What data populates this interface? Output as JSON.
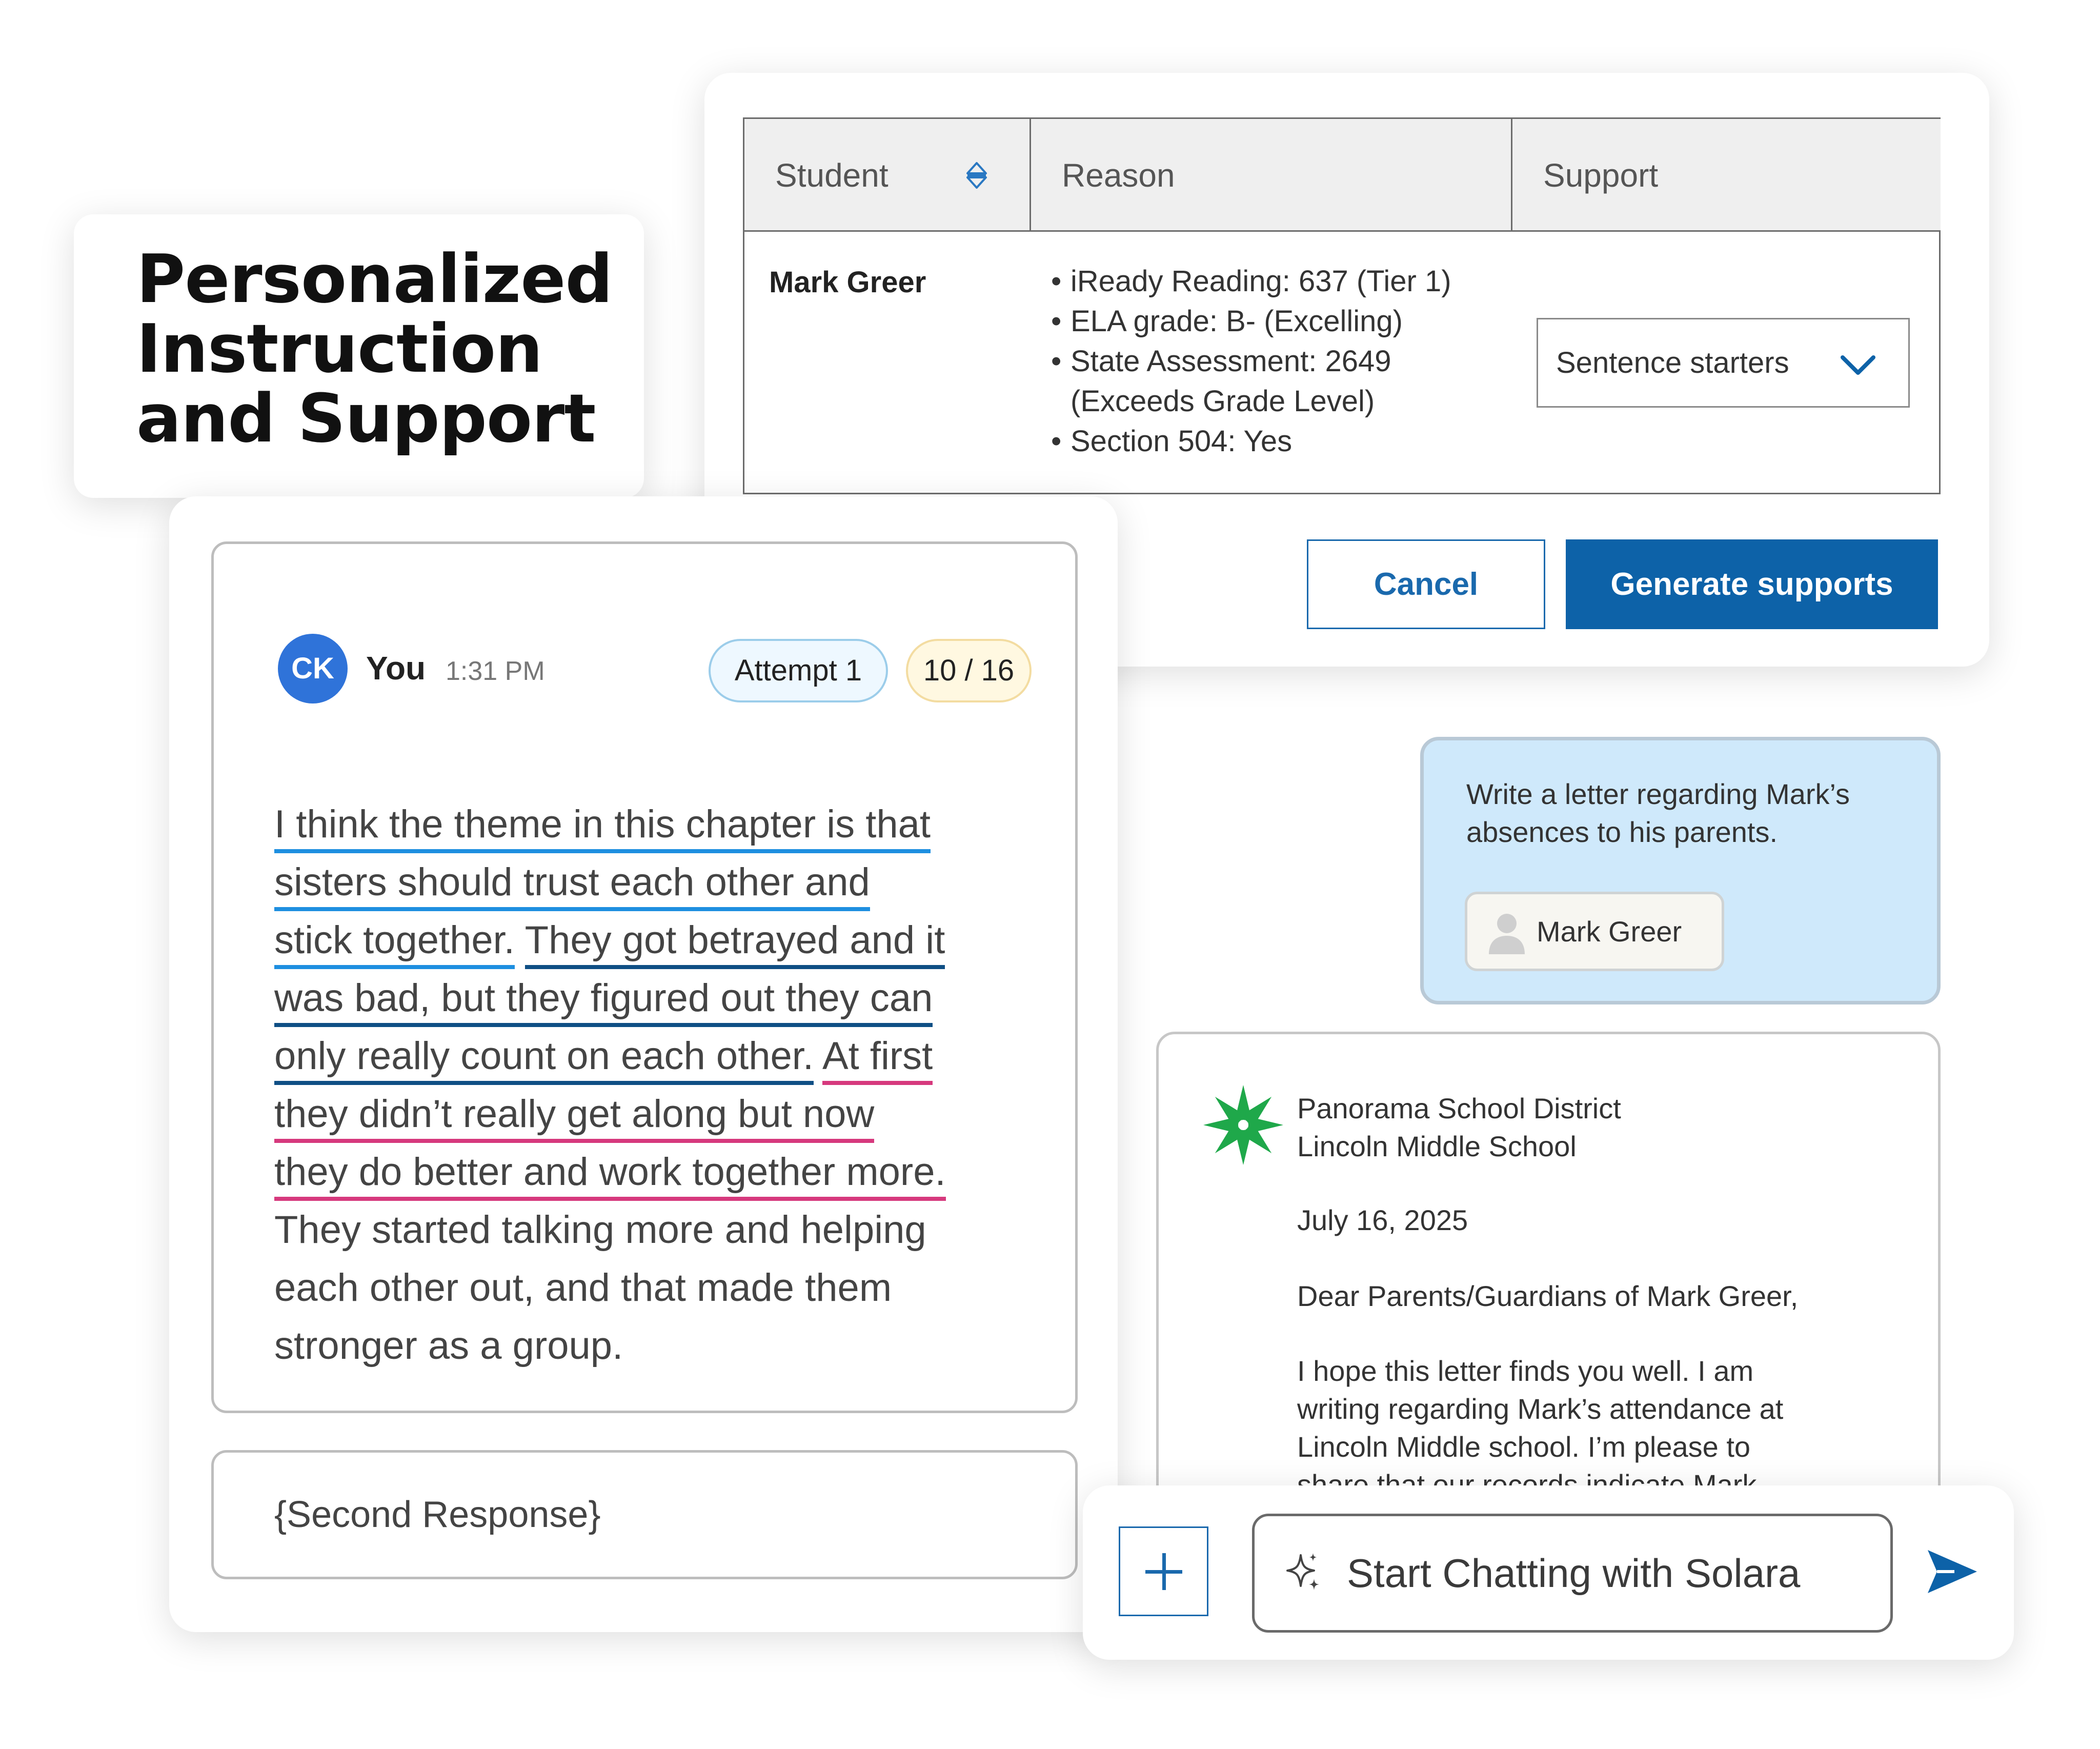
{
  "title_card": {
    "lines": [
      "Personalized",
      "Instruction",
      "and Support"
    ]
  },
  "support_table": {
    "columns": {
      "student": "Student",
      "reason": "Reason",
      "support": "Support"
    },
    "row": {
      "student": "Mark Greer",
      "reasons": [
        "iReady Reading: 637 (Tier 1)",
        "ELA grade: B- (Excelling)",
        "State Assessment: 2649",
        "(Exceeds Grade Level)",
        "Section 504: Yes"
      ],
      "support_selected": "Sentence starters"
    },
    "cancel_label": "Cancel",
    "generate_label": "Generate supports"
  },
  "response": {
    "avatar_initials": "CK",
    "author": "You",
    "time": "1:31 PM",
    "attempt_label": "Attempt 1",
    "score_label": "10 / 16",
    "lines": [
      "I think the theme in this chapter is that",
      "sisters should trust each other and",
      "stick together.",
      "They got betrayed and it",
      "was bad, but they figured out they can",
      "only really count on each other.",
      "At first",
      "they didn’t really get along but now",
      "they do better and work together more.",
      "They started talking more and helping",
      "each other out, and that made them",
      "stronger as a group."
    ],
    "second_response": "{Second Response}"
  },
  "prompt": {
    "text": "Write a letter regarding Mark’s absences to his parents.",
    "chip_label": "Mark Greer"
  },
  "letter": {
    "district": "Panorama School District",
    "school": "Lincoln Middle School",
    "date": "July 16, 2025",
    "greeting": "Dear Parents/Guardians of Mark Greer,",
    "body_lines": [
      "I hope this letter finds you well. I am",
      "writing regarding Mark’s attendance at",
      "Lincoln Middle school. I’m please to",
      "share that our records indicate Mark"
    ]
  },
  "chat": {
    "placeholder": "Start Chatting with Solara"
  },
  "colors": {
    "primary_blue": "#0d62a8",
    "avatar_blue": "#2f73d9",
    "underline_light_blue": "#1e8fe0",
    "underline_dark_blue": "#0f4f85",
    "underline_pink": "#d6397d",
    "prompt_bg": "#cfe9fb",
    "logo_green": "#1fa84a"
  },
  "icons": [
    "sort-icon",
    "chevron-down-icon",
    "person-icon",
    "sparkle-icon",
    "plus-icon",
    "send-icon",
    "district-logo-icon"
  ]
}
